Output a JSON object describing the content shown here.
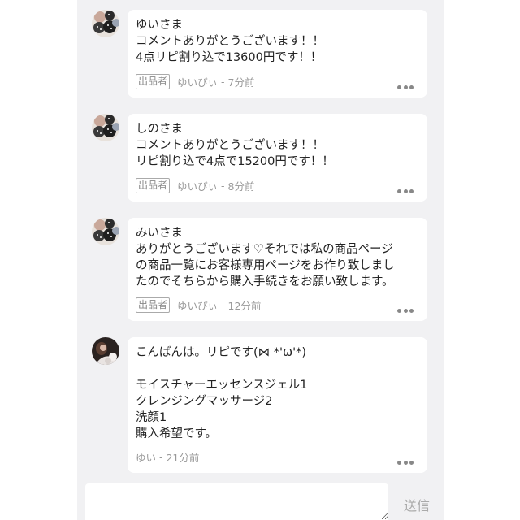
{
  "comments": [
    {
      "lines": [
        "ゆいさま",
        "コメントありがとうございます！！",
        "4点リピ割り込で13600円です！！"
      ],
      "seller_badge": "出品者",
      "author": "ゆいぴぃ",
      "time": "7分前",
      "avatar_icon": "pattern-avatar"
    },
    {
      "lines": [
        "しのさま",
        "コメントありがとうございます！！",
        "リピ割り込で4点で15200円です！！"
      ],
      "seller_badge": "出品者",
      "author": "ゆいぴぃ",
      "time": "8分前",
      "avatar_icon": "pattern-avatar"
    },
    {
      "lines": [
        "みいさま",
        "ありがとうございます♡それでは私の商品ページ",
        "の商品一覧にお客様専用ページをお作り致しまし",
        "たのでそちらから購入手続きをお願い致します。"
      ],
      "seller_badge": "出品者",
      "author": "ゆいぴぃ",
      "time": "12分前",
      "avatar_icon": "pattern-avatar"
    },
    {
      "lines": [
        "こんばんは。リピです(⋈ *'ω'*)",
        "",
        "モイスチャーエッセンスジェル1",
        "クレンジングマッサージ2",
        "洗顔1",
        "購入希望です。"
      ],
      "author": "ゆい",
      "time": "21分前",
      "avatar_icon": "photo-avatar"
    }
  ],
  "separator": " - ",
  "input": {
    "placeholder": ""
  },
  "send_label": "送信"
}
